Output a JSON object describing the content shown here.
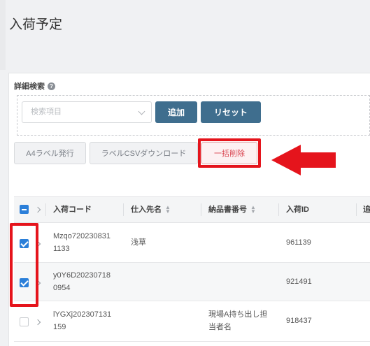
{
  "page": {
    "title": "入荷予定"
  },
  "search": {
    "label": "詳細検索",
    "help_icon": "?",
    "field_placeholder": "検索項目",
    "add_label": "追加",
    "reset_label": "リセット"
  },
  "actions": {
    "a4_label": "A4ラベル発行",
    "csv_label": "ラベルCSVダウンロード",
    "bulk_delete_label": "一括削除"
  },
  "table": {
    "columns": [
      "入荷コード",
      "仕入先名",
      "納品書番号",
      "入荷ID",
      "追"
    ],
    "rows": [
      {
        "checked": true,
        "code": [
          "Mzqo720230831",
          "1133"
        ],
        "supplier": "浅草",
        "invoice": [
          "",
          ""
        ],
        "id": "961139"
      },
      {
        "checked": true,
        "code": [
          "y0Y6D20230718",
          "0954"
        ],
        "supplier": "",
        "invoice": [
          "",
          ""
        ],
        "id": "921491"
      },
      {
        "checked": false,
        "code": [
          "lYGXj202307131",
          "159"
        ],
        "supplier": "",
        "invoice": [
          "現場A持ち出し担",
          "当者名"
        ],
        "id": "918437"
      }
    ]
  },
  "colors": {
    "highlight": "#e5141c",
    "primary": "#3f6e8e",
    "checkbox": "#2b7fd9",
    "danger": "#d9434f"
  },
  "icons": [
    "help-icon",
    "chevron-down-icon",
    "sort-icon",
    "expand-chevron-icon",
    "checkbox-icon",
    "red-arrow"
  ]
}
